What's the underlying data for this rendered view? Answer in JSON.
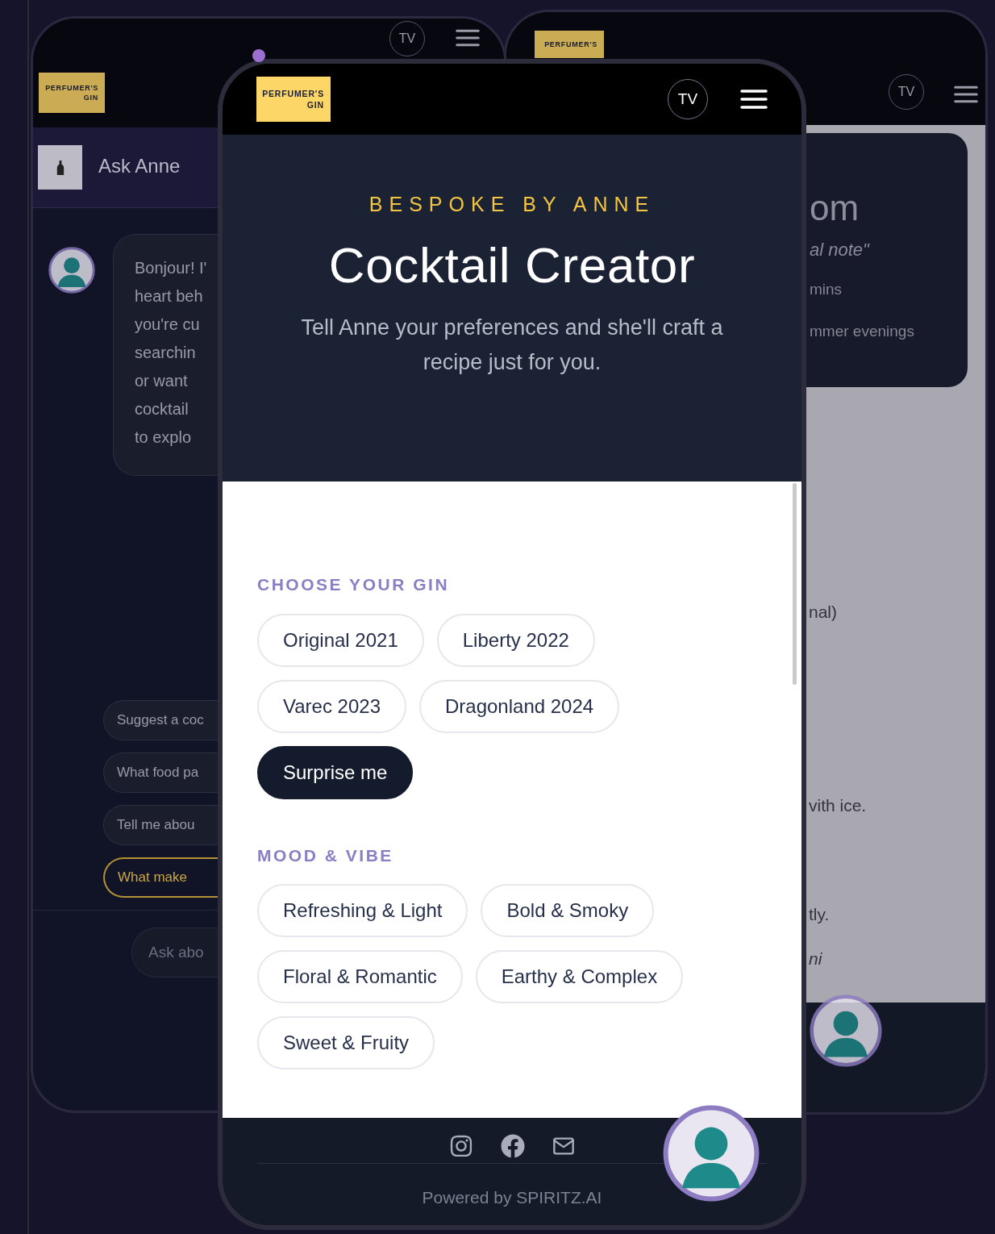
{
  "left_phone": {
    "logo": [
      "PERFUMER'S",
      "GIN"
    ],
    "tv_button": "TV",
    "chat_title": "Ask Anne",
    "message": "Bonjour! I'\nheart beh\nyou're cu\nsearchin\nor want\ncocktail\nto explo",
    "suggestions": [
      {
        "text": "Suggest a coc",
        "selected": false
      },
      {
        "text": "What food pa",
        "selected": false
      },
      {
        "text": "Tell me abou",
        "selected": false
      },
      {
        "text": "What make",
        "selected": true
      }
    ],
    "input": {
      "placeholder": "Ask abo"
    }
  },
  "right_phone": {
    "logo": [
      "PERFUMER'S"
    ],
    "tv_button": "TV",
    "card_lines": [
      {
        "text": "om",
        "kind": "title"
      },
      {
        "text": "al note\"",
        "kind": "quote"
      },
      {
        "text": "mins",
        "kind": "meta"
      },
      {
        "text": "mmer evenings",
        "kind": "meta"
      }
    ],
    "body_lines": [
      {
        "text": "nal)",
        "kind": "plain"
      },
      {
        "text": "vith ice.",
        "kind": "plain"
      },
      {
        "text": "tly.",
        "kind": "plain"
      },
      {
        "text": "ni",
        "kind": "italic"
      }
    ]
  },
  "main_phone": {
    "logo": [
      "PERFUMER'S",
      "GIN"
    ],
    "tv_button": "TV",
    "hero": {
      "eyebrow": "BESPOKE BY ANNE",
      "title": "Cocktail Creator",
      "subtitle": "Tell Anne your preferences and she'll craft a recipe just for you."
    },
    "sections": [
      {
        "heading": "CHOOSE YOUR GIN",
        "options": [
          {
            "label": "Original 2021",
            "selected": false
          },
          {
            "label": "Liberty 2022",
            "selected": false
          },
          {
            "label": "Varec 2023",
            "selected": false
          },
          {
            "label": "Dragonland 2024",
            "selected": false
          },
          {
            "label": "Surprise me",
            "selected": true
          }
        ]
      },
      {
        "heading": "MOOD & VIBE",
        "options": [
          {
            "label": "Refreshing & Light",
            "selected": false
          },
          {
            "label": "Bold & Smoky",
            "selected": false
          },
          {
            "label": "Floral & Romantic",
            "selected": false
          },
          {
            "label": "Earthy & Complex",
            "selected": false
          },
          {
            "label": "Sweet & Fruity",
            "selected": false
          }
        ]
      }
    ],
    "footer": {
      "powered_by": "Powered by SPIRITZ.AI"
    }
  }
}
